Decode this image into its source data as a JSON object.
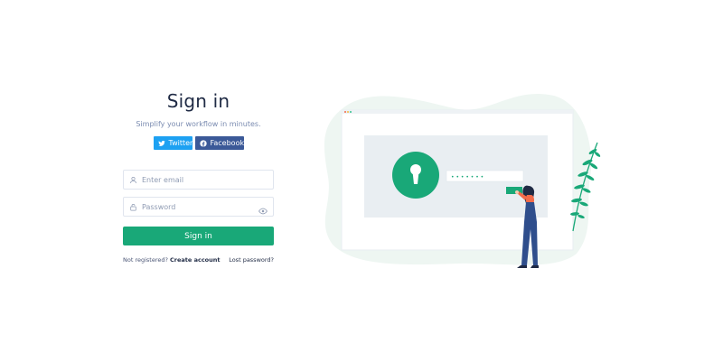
{
  "signin": {
    "title": "Sign in",
    "subtitle": "Simplify your workflow in minutes.",
    "social": {
      "twitter_label": "Twitter",
      "facebook_label": "Facebook"
    },
    "email": {
      "placeholder": "Enter email",
      "value": ""
    },
    "password": {
      "placeholder": "Password",
      "value": ""
    },
    "submit_label": "Sign in",
    "footer": {
      "not_registered": "Not registered?",
      "create_account": "Create account",
      "lost_password": "Lost password?"
    }
  },
  "illustration": {
    "password_mask": "• • • • • • •"
  },
  "colors": {
    "primary": "#19a878",
    "twitter": "#1da1f2",
    "facebook": "#3b5998",
    "blob": "#eef6f2"
  },
  "icons": [
    "twitter-icon",
    "facebook-icon",
    "user-icon",
    "lock-icon",
    "eye-icon",
    "keyhole-icon",
    "fern-icon"
  ]
}
